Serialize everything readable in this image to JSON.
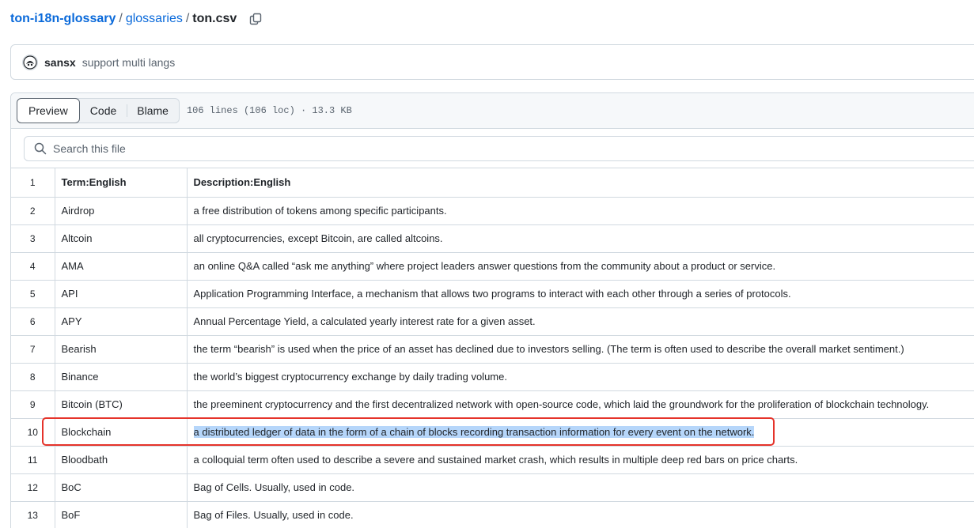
{
  "breadcrumb": {
    "repo": "ton-i18n-glossary",
    "sep": "/",
    "dir": "glossaries",
    "file": "ton.csv"
  },
  "icons": {
    "copy": "copy-icon",
    "search": "search-icon",
    "avatar": "avatar-icon"
  },
  "commit": {
    "author": "sansx",
    "message": "support multi langs"
  },
  "file_header": {
    "tabs": [
      "Preview",
      "Code",
      "Blame"
    ],
    "active_tab": "Preview",
    "meta": "106 lines (106 loc) · 13.3 KB"
  },
  "search": {
    "placeholder": "Search this file"
  },
  "table": {
    "header": {
      "line": "1",
      "term": "Term:English",
      "desc": "Description:English"
    },
    "rows": [
      {
        "line": "2",
        "term": "Airdrop",
        "desc": "a free distribution of tokens among specific participants."
      },
      {
        "line": "3",
        "term": "Altcoin",
        "desc": "all cryptocurrencies, except Bitcoin, are called altcoins."
      },
      {
        "line": "4",
        "term": "AMA",
        "desc": "an online Q&A called “ask me anything” where project leaders answer questions from the community about a product or service."
      },
      {
        "line": "5",
        "term": "API",
        "desc": "Application Programming Interface, a mechanism that allows two programs to interact with each other through a series of protocols."
      },
      {
        "line": "6",
        "term": "APY",
        "desc": "Annual Percentage Yield, a calculated yearly interest rate for a given asset."
      },
      {
        "line": "7",
        "term": "Bearish",
        "desc": "the term “bearish” is used when the price of an asset has declined due to investors selling. (The term is often used to describe the overall market sentiment.)"
      },
      {
        "line": "8",
        "term": "Binance",
        "desc": "the world’s biggest cryptocurrency exchange by daily trading volume."
      },
      {
        "line": "9",
        "term": "Bitcoin (BTC)",
        "desc": "the preeminent cryptocurrency and the first decentralized network with open-source code, which laid the groundwork for the proliferation of blockchain technology."
      },
      {
        "line": "10",
        "term": "Blockchain",
        "desc": "a distributed ledger of data in the form of a chain of blocks recording transaction information for every event on the network."
      },
      {
        "line": "11",
        "term": "Bloodbath",
        "desc": "a colloquial term often used to describe a severe and sustained market crash, which results in multiple deep red bars on price charts."
      },
      {
        "line": "12",
        "term": "BoC",
        "desc": "Bag of Cells. Usually, used in code."
      },
      {
        "line": "13",
        "term": "BoF",
        "desc": "Bag of Files. Usually, used in code."
      }
    ]
  },
  "colors": {
    "link": "#0969da",
    "selection": "#b6d6fa",
    "annotation": "#e5332a"
  }
}
